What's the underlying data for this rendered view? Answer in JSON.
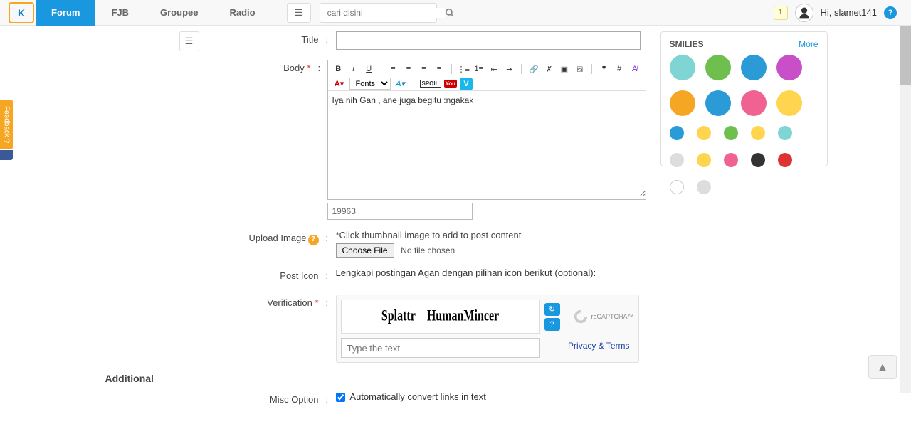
{
  "nav": {
    "forum": "Forum",
    "fjb": "FJB",
    "groupee": "Groupee",
    "radio": "Radio"
  },
  "search": {
    "placeholder": "cari disini"
  },
  "user": {
    "notif": "1",
    "greeting": "Hi, slamet141"
  },
  "labels": {
    "title": "Title",
    "body": "Body",
    "upload": "Upload Image",
    "posticon": "Post Icon",
    "verification": "Verification",
    "additional": "Additional",
    "misc": "Misc Option"
  },
  "body_text": "Iya nih Gan , ane juga begitu :ngakak",
  "char_count": "19963",
  "upload_hint": "*Click thumbnail image to add to post content",
  "choose_file": "Choose File",
  "no_file": "No file chosen",
  "posticon_text": "Lengkapi postingan Agan dengan pilihan icon berikut (optional):",
  "captcha": {
    "word1": "Splattr",
    "word2": "HumanMincer",
    "placeholder": "Type the text",
    "brand": "reCAPTCHA™",
    "privacy": "Privacy & Terms"
  },
  "misc_text": "Automatically convert links in text",
  "smilies": {
    "title": "SMILIES",
    "more": "More"
  },
  "toolbar": {
    "fonts": "Fonts",
    "spoil": "SPOIL",
    "yt": "You",
    "vimeo": "V"
  },
  "feedback": "Feedback ?"
}
